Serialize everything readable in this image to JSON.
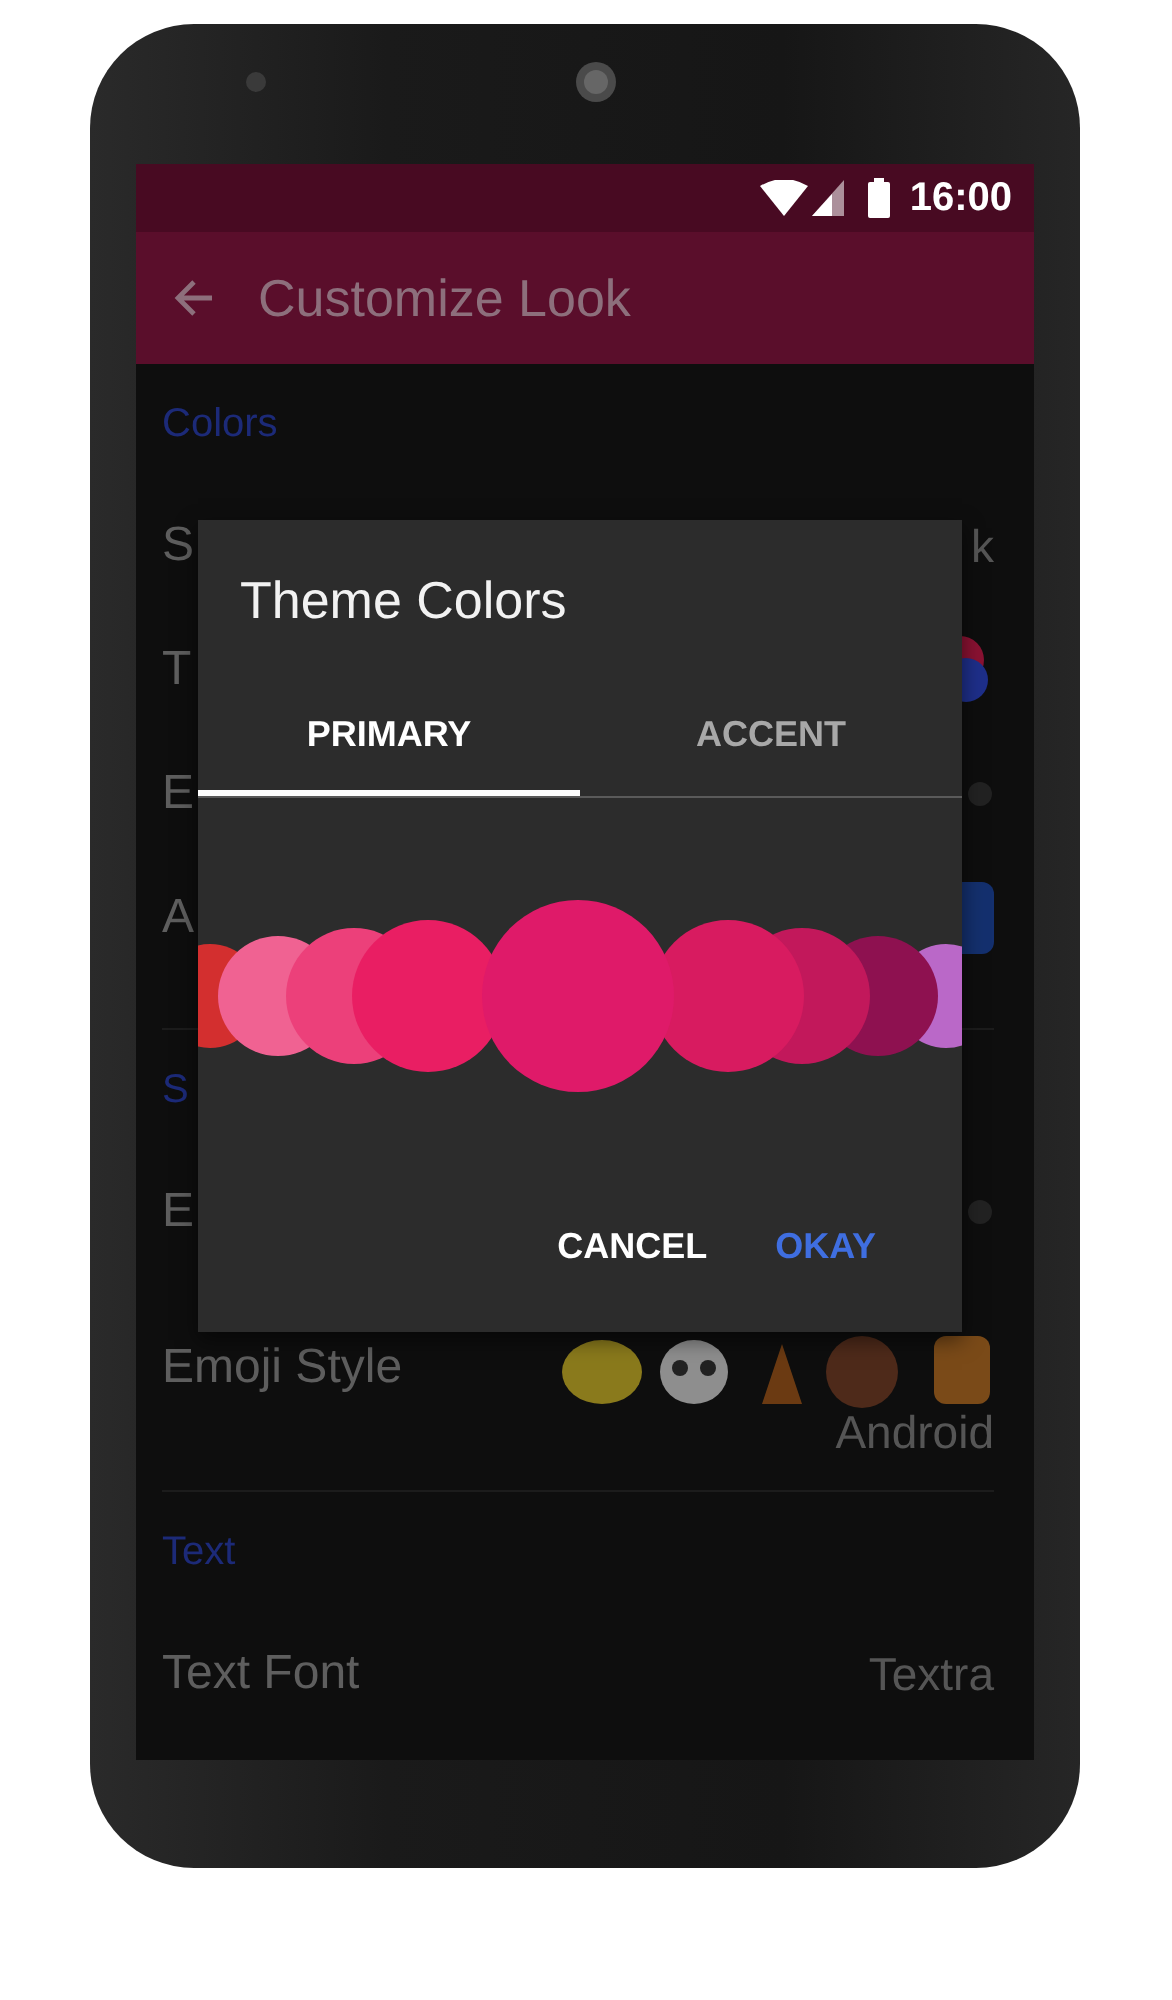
{
  "status_bar": {
    "time": "16:00"
  },
  "toolbar": {
    "title": "Customize Look"
  },
  "sections": [
    {
      "header": "Colors",
      "rows": [
        {
          "kind": "text",
          "label": "S",
          "value": "k"
        },
        {
          "kind": "swatch",
          "label": "T"
        },
        {
          "kind": "toggle",
          "label": "E"
        },
        {
          "kind": "bubble",
          "label": "A"
        }
      ]
    },
    {
      "header": "S",
      "rows": [
        {
          "kind": "toggle",
          "label": "E"
        },
        {
          "kind": "emoji",
          "label": "Emoji Style",
          "value": "Android"
        }
      ]
    },
    {
      "header": "Text",
      "rows": [
        {
          "kind": "text",
          "label": "Text Font",
          "value": "Textra"
        }
      ]
    }
  ],
  "dialog": {
    "title": "Theme Colors",
    "tabs": [
      {
        "label": "PRIMARY",
        "selected": true
      },
      {
        "label": "ACCENT",
        "selected": false
      }
    ],
    "swatches": [
      {
        "color": "#d32f2f",
        "selected": false
      },
      {
        "color": "#f06292",
        "selected": false
      },
      {
        "color": "#ec407a",
        "selected": false
      },
      {
        "color": "#e91e63",
        "selected": false
      },
      {
        "color": "#df1a69",
        "selected": true
      },
      {
        "color": "#d81b60",
        "selected": false
      },
      {
        "color": "#c2185b",
        "selected": false
      },
      {
        "color": "#8e1150",
        "selected": false
      },
      {
        "color": "#ba68c8",
        "selected": false
      }
    ],
    "buttons": [
      {
        "label": "CANCEL",
        "kind": "neutral"
      },
      {
        "label": "OKAY",
        "kind": "primary"
      }
    ]
  }
}
